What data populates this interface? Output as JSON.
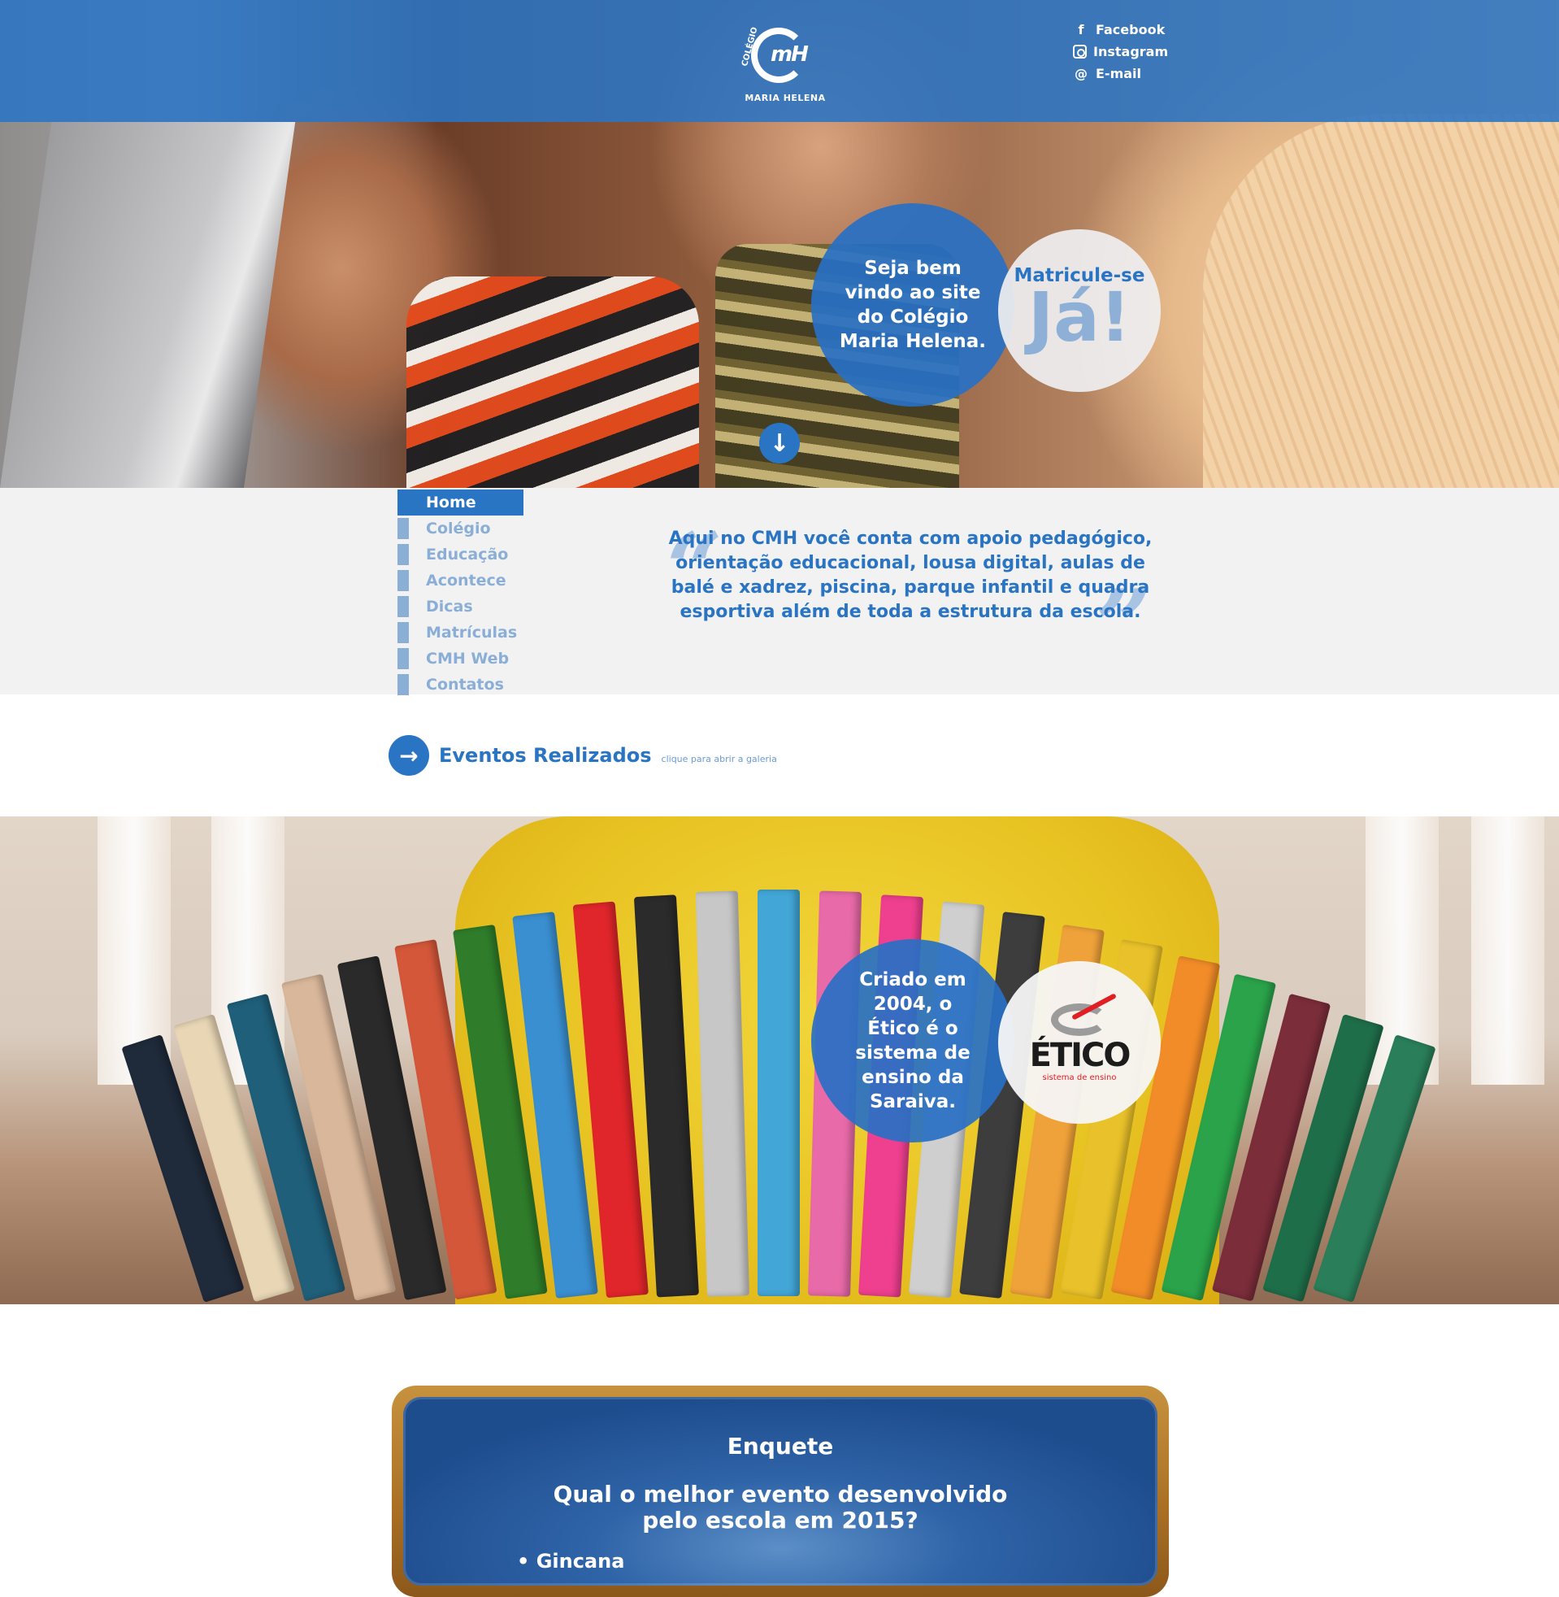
{
  "header": {
    "logo_top": "COLÉGIO",
    "logo_mark": "mH",
    "logo_name": "MARIA HELENA",
    "social": [
      {
        "icon": "facebook-icon",
        "label": "Facebook"
      },
      {
        "icon": "instagram-icon",
        "label": "Instagram"
      },
      {
        "icon": "email-icon",
        "label": "E-mail"
      }
    ]
  },
  "hero": {
    "welcome": "Seja bem vindo ao site do Colégio Maria Helena.",
    "cta_small": "Matricule-se",
    "cta_big": "Já!",
    "scroll_icon": "arrow-down-icon"
  },
  "nav": {
    "items": [
      "Home",
      "Colégio",
      "Educação",
      "Acontece",
      "Dicas",
      "Matrículas",
      "CMH Web",
      "Contatos"
    ],
    "active": "Home"
  },
  "quote": {
    "text": "Aqui no CMH você conta com apoio pedagógico, orientação educacional, lousa digital, aulas de balé e xadrez, piscina, parque infantil e quadra esportiva além de toda a estrutura da escola."
  },
  "eventos": {
    "title": "Eventos Realizados",
    "hint": "clique para abrir a galeria",
    "icon": "arrow-right-icon"
  },
  "etico": {
    "text": "Criado em 2004, o Ético é o sistema de ensino da Saraiva.",
    "brand": "ÉTICO",
    "brand_sub": "sistema de ensino"
  },
  "enquete": {
    "title": "Enquete",
    "question": "Qual o melhor evento desenvolvido pelo escola em 2015?",
    "option": "• Gincana"
  },
  "colors": {
    "primary": "#2a74c4",
    "light_blue": "#8aaed6",
    "band": "#f2f2f2",
    "etico_red": "#e01e24"
  }
}
